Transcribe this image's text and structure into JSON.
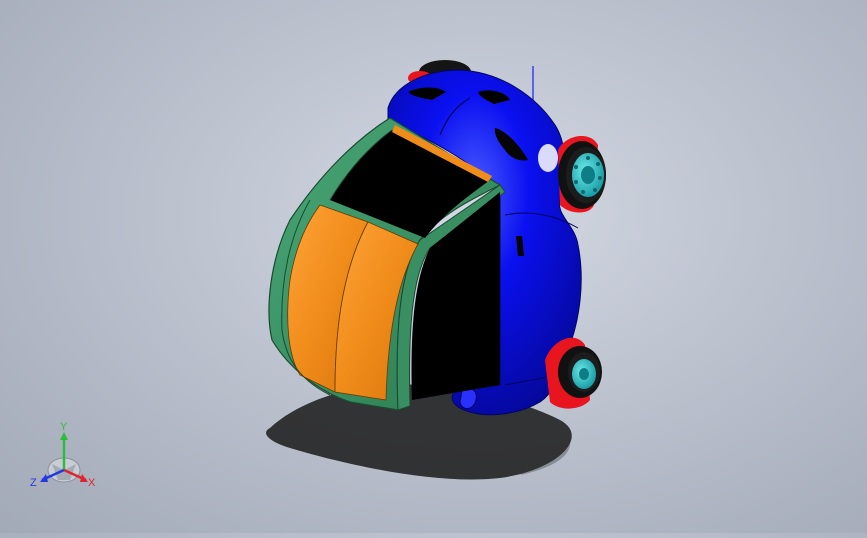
{
  "viewport": {
    "background_top": "#d4d9e3",
    "background_bottom": "#a2a9b7",
    "model": {
      "body_color": "#0a10f0",
      "cabin_frame_color": "#3a8f62",
      "window_color": "#000000",
      "seat_color": "#f08c1a",
      "wheel_rim_color": "#2ec8c8",
      "fender_color": "#e8141e"
    }
  },
  "triad": {
    "x_label": "X",
    "y_label": "Y",
    "z_label": "Z",
    "x_color": "#e0242c",
    "y_color": "#2ebd3a",
    "z_color": "#2438e0"
  }
}
